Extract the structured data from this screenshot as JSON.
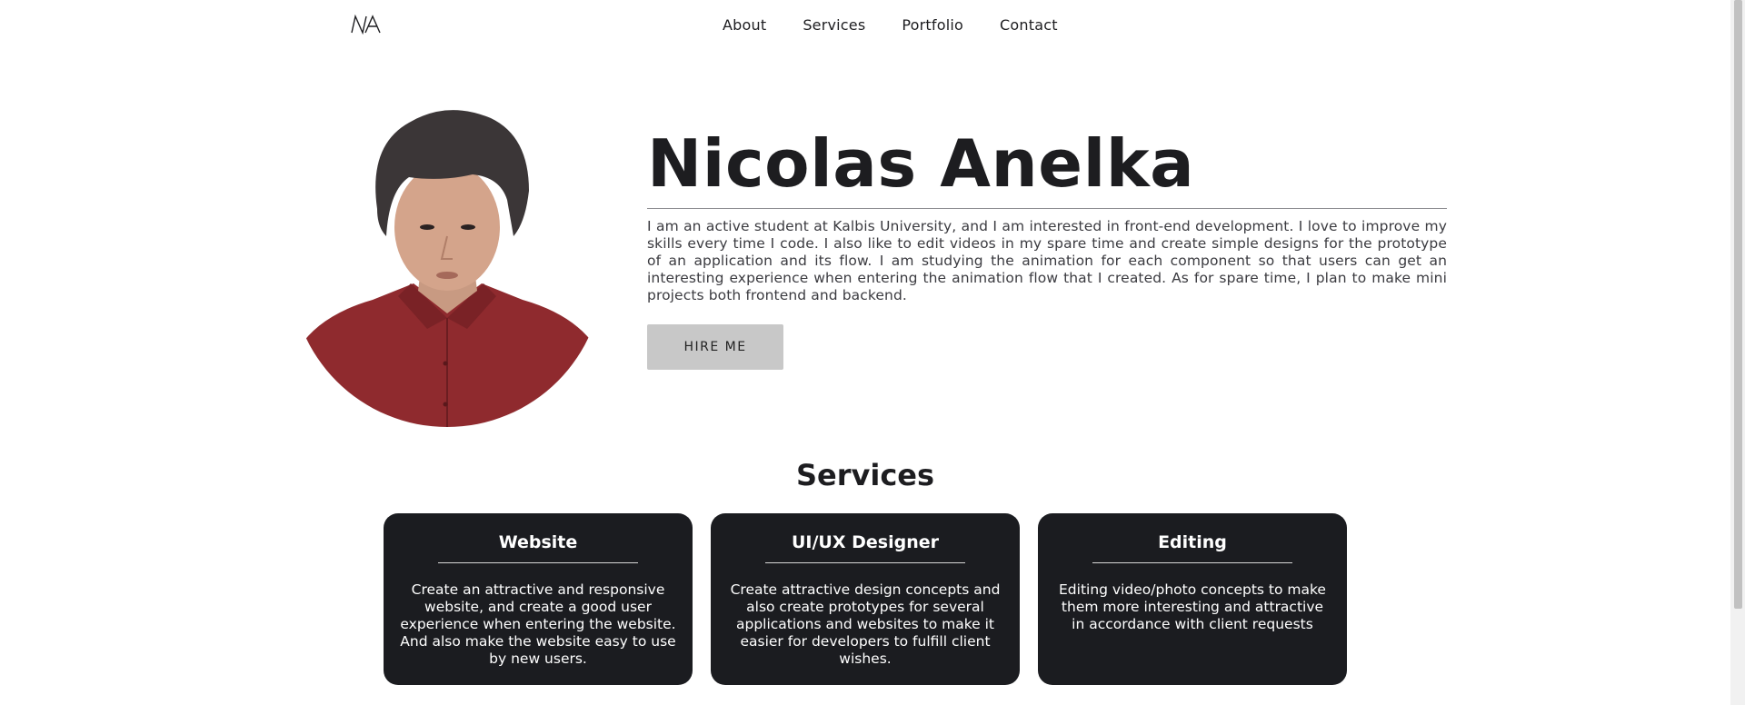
{
  "nav": {
    "logo_icon": "na-monogram-logo",
    "items": [
      "About",
      "Services",
      "Portfolio",
      "Contact"
    ]
  },
  "hero": {
    "name": "Nicolas Anelka",
    "description": "I am an active student at Kalbis University, and I am interested in front-end development. I love to improve my skills every time I code. I also like to edit videos in my spare time and create simple designs for the prototype of an application and its flow. I am studying the animation for each component so that users can get an interesting experience when entering the animation flow that I created. As for spare time, I plan to make mini projects both frontend and backend.",
    "hire_label": "HIRE ME",
    "avatar_icon": "profile-photo"
  },
  "services": {
    "title": "Services",
    "cards": [
      {
        "title": "Website",
        "description": "Create an attractive and responsive website, and create a good user experience when entering the website. And also make the website easy to use by new users."
      },
      {
        "title": "UI/UX Designer",
        "description": "Create attractive design concepts and also create prototypes for several applications and websites to make it easier for developers to fulfill client wishes."
      },
      {
        "title": "Editing",
        "description": "Editing video/photo concepts to make them more interesting and attractive in accordance with client requests"
      }
    ]
  },
  "colors": {
    "card_bg": "#1b1c20",
    "button_bg": "#c8c8c8",
    "shirt": "#8f2a2e",
    "text_dark": "#1d1d20"
  }
}
